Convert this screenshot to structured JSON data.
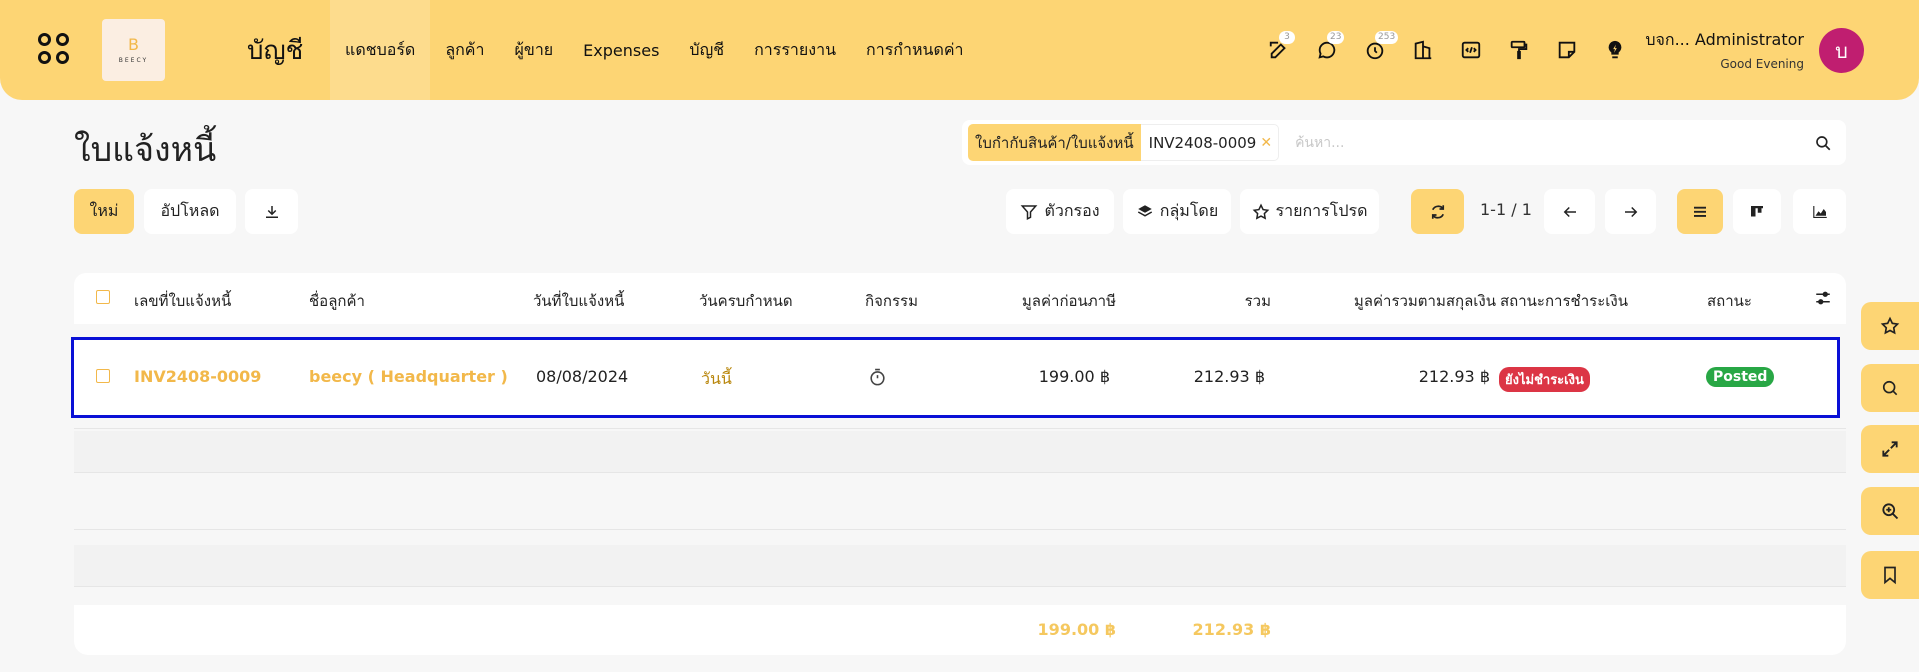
{
  "app": {
    "logo_initial": "B",
    "logo_text": "BEECY",
    "title": "บัญชี"
  },
  "nav": {
    "items": [
      {
        "label": "แดชบอร์ด"
      },
      {
        "label": "ลูกค้า"
      },
      {
        "label": "ผู้ขาย"
      },
      {
        "label": "Expenses"
      },
      {
        "label": "บัญชี"
      },
      {
        "label": "การรายงาน"
      },
      {
        "label": "การกำหนดค่า"
      }
    ]
  },
  "systray": {
    "activity_count": "3",
    "messages_count": "23",
    "timer_count": "253"
  },
  "user": {
    "name": "บจก... Administrator",
    "greeting": "Good Evening",
    "avatar_initial": "บ"
  },
  "page": {
    "title": "ใบแจ้งหนี้"
  },
  "search": {
    "facet_label": "ใบกำกับสินค้า/ใบแจ้งหนี้",
    "facet_value": "INV2408-0009",
    "placeholder": "ค้นหา..."
  },
  "toolbar": {
    "new_label": "ใหม่",
    "upload_label": "อัปโหลด",
    "filter_label": "ตัวกรอง",
    "groupby_label": "กลุ่มโดย",
    "favorites_label": "รายการโปรด",
    "pager": "1-1 / 1"
  },
  "table": {
    "columns": {
      "number": "เลขที่ใบแจ้งหนี้",
      "customer": "ชื่อลูกค้า",
      "invoice_date": "วันที่ใบแจ้งหนี้",
      "due_date": "วันครบกำหนด",
      "activity": "กิจกรรม",
      "untaxed": "มูลค่าก่อนภาษี",
      "total": "รวม",
      "total_currency": "มูลค่ารวมตามสกุลเงิน",
      "payment_status": "สถานะการชำระเงิน",
      "status": "สถานะ"
    },
    "rows": [
      {
        "number": "INV2408-0009",
        "customer": "beecy ( Headquarter )",
        "invoice_date": "08/08/2024",
        "due_date": "วันนี้",
        "untaxed": "199.00 ฿",
        "total": "212.93 ฿",
        "total_currency": "212.93 ฿",
        "payment_status": "ยังไม่ชำระเงิน",
        "status": "Posted"
      }
    ],
    "footer": {
      "untaxed_sum": "199.00 ฿",
      "total_sum": "212.93 ฿"
    }
  },
  "colors": {
    "brand": "#fdd574",
    "accent": "#f2b84a",
    "danger": "#dc3545",
    "success": "#28a745",
    "avatar": "#c01e70",
    "selection_border": "#0a10d6"
  }
}
